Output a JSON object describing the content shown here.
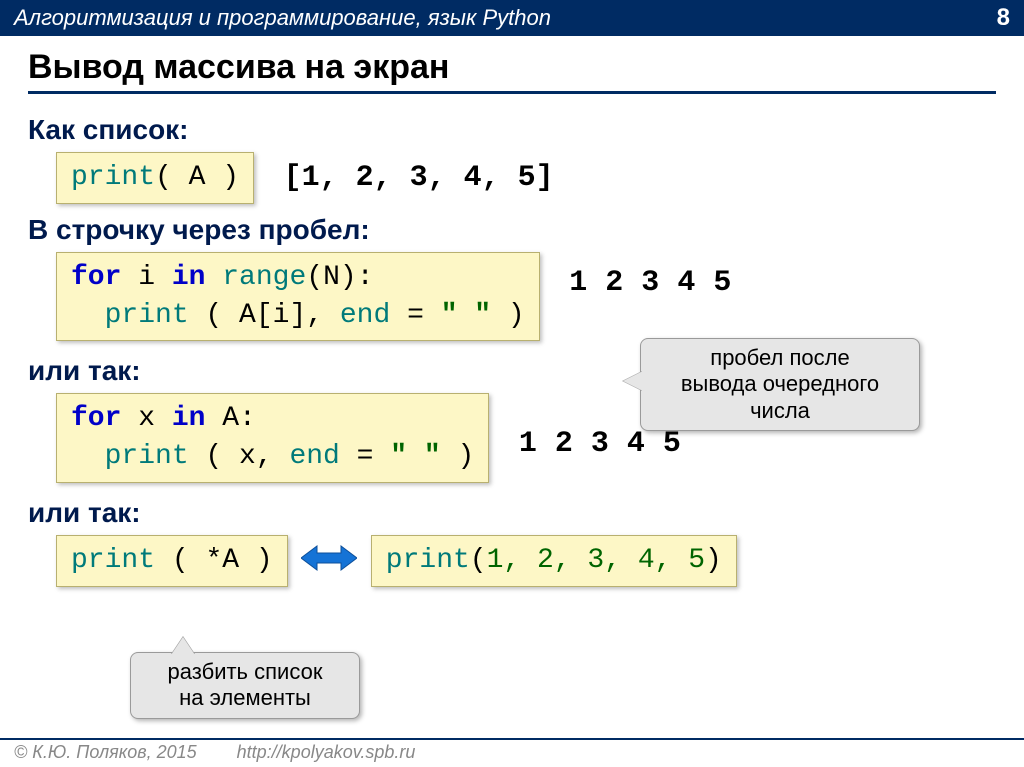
{
  "header": {
    "breadcrumb": "Алгоритмизация и программирование, язык Python",
    "page_number": "8"
  },
  "title": "Вывод массива на экран",
  "subheads": {
    "as_list": "Как списoк:",
    "in_row": "В строчку через пробел:",
    "or_so_1": "или так:",
    "or_so_2": "или так:"
  },
  "code": {
    "print_a": {
      "func": "print",
      "arg": "( A )"
    },
    "output_list": "[1, 2, 3, 4, 5]",
    "for_range": {
      "line1_kw1": "for",
      "line1_var": " i ",
      "line1_kw2": "in",
      "line1_func": " range",
      "line1_rest": "(N):",
      "line2_func": "print",
      "line2_mid": " ( A[i], ",
      "line2_end_kw": "end",
      "line2_eq": " = ",
      "line2_str": "\" \"",
      "line2_close": " )"
    },
    "output_spaced_1": "1 2 3 4 5",
    "for_x": {
      "line1_kw1": "for",
      "line1_var": " x ",
      "line1_kw2": "in",
      "line1_rest": " A:",
      "line2_func": "print",
      "line2_mid": " ( x, ",
      "line2_end_kw": "end",
      "line2_eq": " = ",
      "line2_str": "\" \"",
      "line2_close": " )"
    },
    "output_spaced_2": "1 2 3 4 5",
    "print_star": {
      "func": "print",
      "open": " ( ",
      "star": "*A",
      "close": " )"
    },
    "print_unpacked": {
      "func": "print",
      "open": "(",
      "args": "1, 2, 3, 4, 5",
      "close": ")"
    }
  },
  "callouts": {
    "space_after": "пробел после\nвывода очередного\nчисла",
    "split_list": "разбить список\nна элементы"
  },
  "footer": {
    "copyright": "© К.Ю. Поляков, 2015",
    "url": "http://kpolyakov.spb.ru"
  }
}
